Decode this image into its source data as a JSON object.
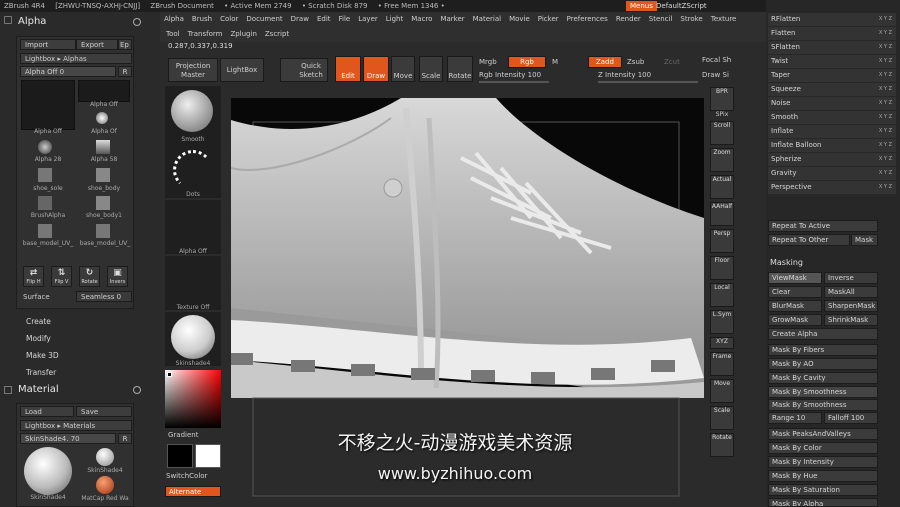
{
  "titlebar": {
    "app": "ZBrush 4R4",
    "serial": "[ZHWU-TNSQ-AXHJ-CNJJ]",
    "doc": "ZBrush Document",
    "active_mem": "• Active Mem 2749",
    "scratch": "• Scratch Disk 879",
    "free_mem": "• Free Mem 1346 •",
    "menus": "Menus",
    "script": "DefaultZScript"
  },
  "menu": [
    "Alpha",
    "Brush",
    "Color",
    "Document",
    "Draw",
    "Edit",
    "File",
    "Layer",
    "Light",
    "Macro",
    "Marker",
    "Material",
    "Movie",
    "Picker",
    "Preferences",
    "Render",
    "Stencil",
    "Stroke",
    "Texture"
  ],
  "menu2": [
    "Tool",
    "Transform",
    "Zplugin",
    "Zscript"
  ],
  "coords": "0.287,0.337,0.319",
  "alpha": {
    "title": "Alpha",
    "import": "Import",
    "export": "Export",
    "ep": "Ep",
    "lightbox": "Lightbox ▸ Alphas",
    "alpha_off": "Alpha Off 0",
    "r": "R",
    "cells": [
      "Alpha Off",
      "Alpha Off",
      "Alpha Of",
      "Alpha 28",
      "Alpha 58",
      "shoe_sole",
      "shoe_body",
      "BrushAlpha",
      "shoe_body1",
      "base_model_UV_",
      "base_model_UV_"
    ],
    "icons": [
      {
        "sym": "⇄",
        "label": "Flip H"
      },
      {
        "sym": "⇅",
        "label": "Flip V"
      },
      {
        "sym": "↻",
        "label": "Rotate"
      },
      {
        "sym": "▣",
        "label": "Invers"
      }
    ],
    "surface": "Surface",
    "seamless": "Seamless 0",
    "links": [
      "Create",
      "Modify",
      "Make 3D",
      "Transfer"
    ]
  },
  "material": {
    "title": "Material",
    "load": "Load",
    "save": "Save",
    "lightbox": "Lightbox ▸ Materials",
    "skinshade": "SkinShade4. 70",
    "r": "R",
    "cells": [
      "SkinShade4",
      "SkinShade4",
      "MatCap Red Wa"
    ]
  },
  "toolbar": {
    "projection": "Projection Master",
    "lightbox": "LightBox",
    "quicksketch": "Quick Sketch",
    "edit": "Edit",
    "draw": "Draw",
    "move": "Move",
    "scale": "Scale",
    "rotate": "Rotate",
    "mrgb": "Mrgb",
    "rgb": "Rgb",
    "m": "M",
    "zadd": "Zadd",
    "zsub": "Zsub",
    "zcut": "Zcut",
    "rgb_intensity": "Rgb Intensity 100",
    "z_intensity": "Z Intensity 100",
    "focal": "Focal Sh",
    "drawsize": "Draw Si"
  },
  "shelf": [
    "Smooth",
    "Dots",
    "Alpha Off",
    "Texture Off",
    "Skinshade4"
  ],
  "shelf_color": {
    "gradient": "Gradient",
    "switch": "SwitchColor",
    "alternate": "Alternate"
  },
  "rshelf": [
    "BPR",
    "SPix",
    "Scroll",
    "Zoom",
    "Actual",
    "AAHalf",
    "Persp",
    "Floor",
    "Local",
    "L.Sym",
    "XYZ",
    "Frame",
    "Move",
    "Scale",
    "Rotate"
  ],
  "deform": [
    {
      "label": "RFlatten",
      "xyz": "X Y Z"
    },
    {
      "label": "Flatten",
      "xyz": "X Y Z"
    },
    {
      "label": "SFlatten",
      "xyz": "X Y Z"
    },
    {
      "label": "Twist",
      "xyz": "X Y Z"
    },
    {
      "label": "Taper",
      "xyz": "X Y Z"
    },
    {
      "label": "Squeeze",
      "xyz": "X Y Z"
    },
    {
      "label": "Noise",
      "xyz": "X Y Z"
    },
    {
      "label": "Smooth",
      "xyz": "X Y Z"
    },
    {
      "label": "Inflate",
      "xyz": "X Y Z"
    },
    {
      "label": "Inflate Balloon",
      "xyz": "X Y Z"
    },
    {
      "label": "Spherize",
      "xyz": "X Y Z"
    },
    {
      "label": "Gravity",
      "xyz": "X Y Z"
    },
    {
      "label": "Perspective",
      "xyz": "X Y Z"
    }
  ],
  "repeat": {
    "active": "Repeat To Active",
    "other": "Repeat To Other",
    "mask": "Mask"
  },
  "masking": {
    "title": "Masking",
    "viewmask": "ViewMask",
    "inverse": "Inverse",
    "clear": "Clear",
    "maskall": "MaskAll",
    "blurmask": "BlurMask",
    "sharpenmask": "SharpenMask",
    "growmask": "GrowMask",
    "shrinkmask": "ShrinkMask",
    "createalpha": "Create Alpha",
    "items": [
      "Mask By Fibers",
      "Mask By AO",
      "Mask By Cavity",
      "Mask By Smoothness",
      "Mask By Smoothness"
    ],
    "range": "Range 10",
    "falloff": "Falloff 100",
    "items2": [
      "Mask PeaksAndValleys",
      "Mask By Color",
      "Mask By Intensity",
      "Mask By Hue",
      "Mask By Saturation",
      "Mask By Alpha"
    ]
  },
  "watermark": {
    "line1": "不移之火-动漫游戏美术资源",
    "line2": "www.byzhihuo.com"
  }
}
